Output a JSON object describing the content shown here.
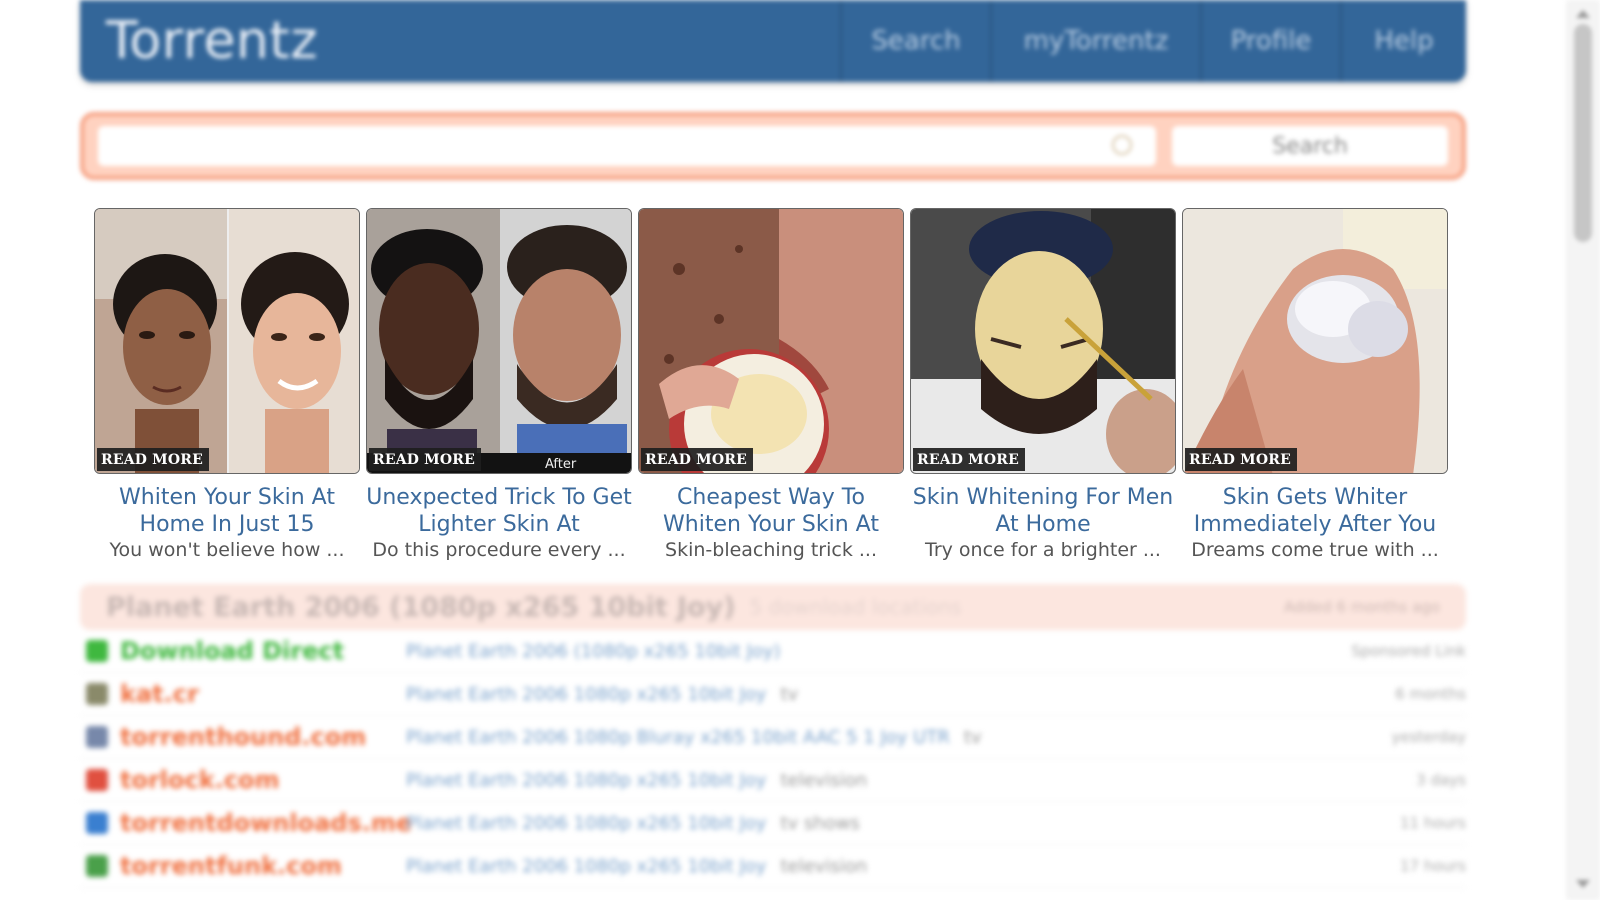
{
  "header": {
    "logo": "Torrentz",
    "nav": [
      "Search",
      "myTorrentz",
      "Profile",
      "Help"
    ]
  },
  "search": {
    "placeholder": "",
    "button": "Search"
  },
  "ads": [
    {
      "title": "Whiten Your Skin At Home In Just 15",
      "desc": "You won't believe how ...",
      "badge": "READ MORE"
    },
    {
      "title": "Unexpected Trick To Get Lighter Skin At",
      "desc": "Do this procedure every ...",
      "badge": "READ MORE",
      "after_label": "After"
    },
    {
      "title": "Cheapest Way To Whiten Your Skin At",
      "desc": "Skin-bleaching trick ...",
      "badge": "READ MORE"
    },
    {
      "title": "Skin Whitening For Men At Home",
      "desc": "Try once for a brighter ...",
      "badge": "READ MORE"
    },
    {
      "title": "Skin Gets Whiter Immediately After You",
      "desc": "Dreams come true with ...",
      "badge": "READ MORE"
    }
  ],
  "results": {
    "header_title": "Planet Earth 2006 (1080p x265 10bit Joy)",
    "header_sub": "5 download locations",
    "header_added": "Added 6 months ago",
    "rows": [
      {
        "site": "Download Direct",
        "name": "Planet Earth 2006 (1080p x265 10bit Joy)",
        "tag": "",
        "time": "Sponsored Link",
        "site_color": "#3fb83f",
        "icon_color": "#3fb83f"
      },
      {
        "site": "kat.cr",
        "name": "Planet Earth 2006 1080p x265 10bit Joy",
        "tag": "tv",
        "time": "6 months",
        "site_color": "#f07040",
        "icon_color": "#8a8a6a"
      },
      {
        "site": "torrenthound.com",
        "name": "Planet Earth 2006 1080p Bluray x265 10bit AAC 5 1 Joy UTR",
        "tag": "tv",
        "time": "yesterday",
        "site_color": "#f07040",
        "icon_color": "#7788aa"
      },
      {
        "site": "torlock.com",
        "name": "Planet Earth 2006 1080p x265 10bit Joy",
        "tag": "television",
        "time": "3 days",
        "site_color": "#f07040",
        "icon_color": "#e05040"
      },
      {
        "site": "torrentdownloads.me",
        "name": "Planet Earth 2006 1080p x265 10bit Joy",
        "tag": "tv shows",
        "time": "11 hours",
        "site_color": "#f07040",
        "icon_color": "#3a7fd0"
      },
      {
        "site": "torrentfunk.com",
        "name": "Planet Earth 2006 1080p x265 10bit Joy",
        "tag": "television",
        "time": "17 hours",
        "site_color": "#f07040",
        "icon_color": "#4aa04a"
      }
    ]
  }
}
